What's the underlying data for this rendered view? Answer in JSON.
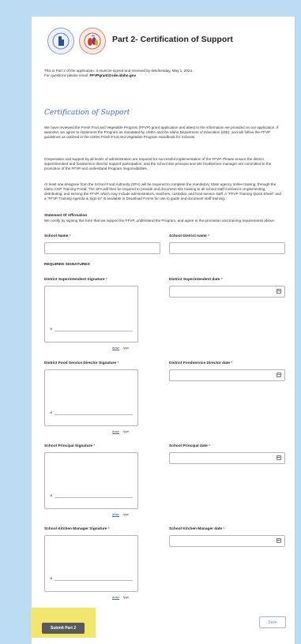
{
  "header": {
    "title": "Part 2- Certification of Support"
  },
  "intro": {
    "line1": "This is Part 2 of the application. It must be signed and received by Wednesday, May 1, 2024.",
    "line2_prefix": "For questions please email: ",
    "email": "FFVPgrant@sde.idaho.gov"
  },
  "section_title": "Certification of Support",
  "paragraphs": [
    "We have reviewed the Fresh Fruit and Vegetable Program (FFVP) grant application and attest to the information we provided on our application. If awarded, we agree to implement the Program as mandated by USDA and the Idaho Department of Education (IDE), and will follow the FFVP guidelines as outlined in the USDA Fresh Fruit and Vegetable Program Handbook for Schools.",
    "Cooperation and support by all levels of administration are required for successful implementation of the FFVP. Please ensure the district superintendent and foodservice director support participation, and the school site principal and site foodservice manager are committed to the promotion of the FFVP and understand Program responsibilities.",
    "At least one designee from the School Food Authority (SFA) will be required to complete the mandatory State agency online training, through the Idaho CNP Training Portal. The SFA will then be required to provide and document site training to all school staff involved in implementing, distributing, and serving the FFVP, which may include administrators, teachers, custodial, and food service staff. A \"FFVP Training Quick Sheet\" and a \"FFVP Training Agenda & Sign-In\" is available in Download Forms for use to guide and document staff training."
  ],
  "affirmation": {
    "heading": "Statement Of Affirmation",
    "text": "We certify by signing this form that we support the FFVP, understand the Program, and agree to the promotion and training requirements above."
  },
  "fields": {
    "school_name": "School Name",
    "district_name": "School District name",
    "required": "*"
  },
  "required_signatures": "REQUIRED SIGNATURES",
  "signatures": [
    {
      "label": "District Superintendent Signature",
      "date_label": "District Superintendent date"
    },
    {
      "label": "District Food Service Director Signature",
      "date_label": "District Foodservice Director date"
    },
    {
      "label": "School Principal Signature",
      "date_label": "School Principal date"
    },
    {
      "label": "School Kitchen Manager Signature",
      "date_label": "School Kitchen Manager date"
    }
  ],
  "sig_mark": "×",
  "tabs": {
    "draw": "draw",
    "type": "type"
  },
  "buttons": {
    "submit": "Submit Part 2",
    "save": "Save"
  },
  "icons": [
    "idaho-department-of-education-logo",
    "ffvp-logo",
    "calendar-icon"
  ]
}
